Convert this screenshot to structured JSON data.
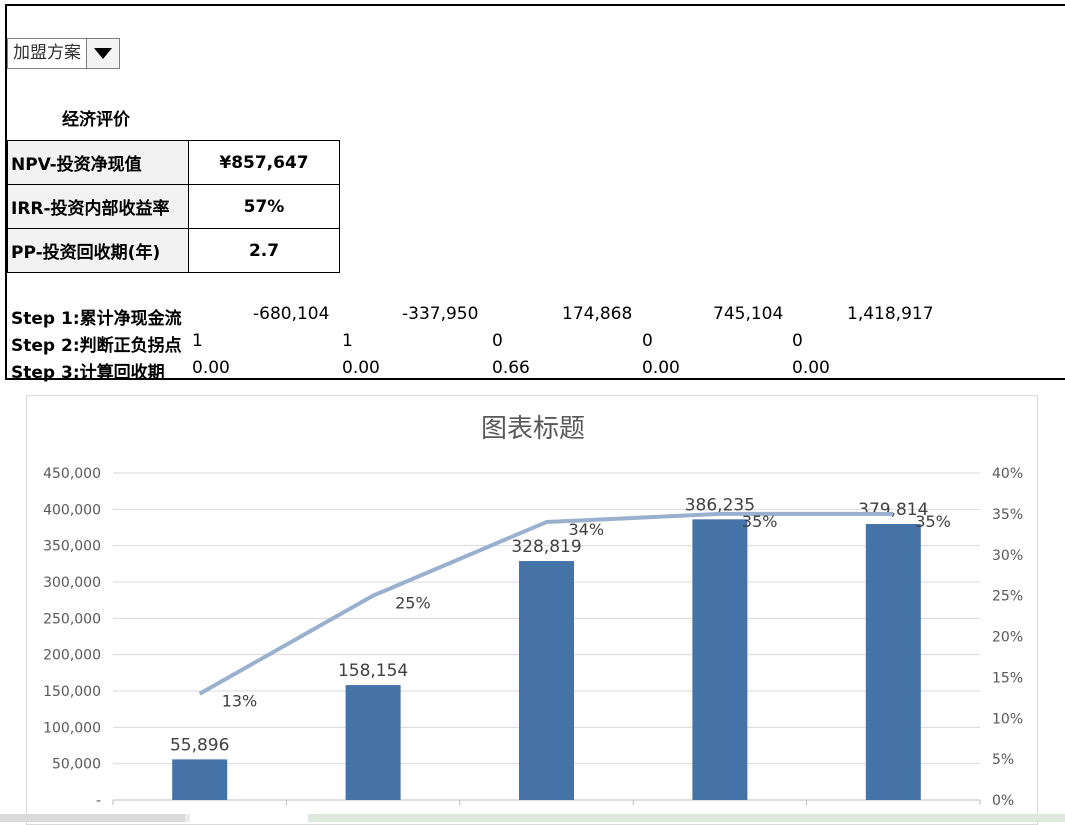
{
  "dropdown": {
    "value": "加盟方案"
  },
  "evaluation": {
    "title": "经济评价",
    "rows": [
      {
        "label": "NPV-投资净现值",
        "value": "¥857,647"
      },
      {
        "label": "IRR-投资内部收益率",
        "value": "57%"
      },
      {
        "label": "PP-投资回收期(年)",
        "value": "2.7"
      }
    ]
  },
  "steps": [
    {
      "label": "Step 1:累计净现金流",
      "values": [
        "-680,104",
        "-337,950",
        "174,868",
        "745,104",
        "1,418,917"
      ]
    },
    {
      "label": "Step 2:判断正负拐点",
      "values": [
        "1",
        "1",
        "0",
        "0",
        "0"
      ]
    },
    {
      "label": "Step 3:计算回收期",
      "values": [
        "0.00",
        "0.00",
        "0.66",
        "0.00",
        "0.00"
      ]
    }
  ],
  "colors": {
    "bar": "#4573a7",
    "line": "#99b0cf",
    "grid": "#d9d9d9",
    "text": "#595959"
  },
  "chart_data": {
    "type": "bar",
    "title": "图表标题",
    "categories": [
      "",
      "",
      "",
      "",
      ""
    ],
    "ylim": [
      0,
      450000
    ],
    "y2lim": [
      0,
      0.4
    ],
    "yticks": [
      "-",
      "50,000",
      "100,000",
      "150,000",
      "200,000",
      "250,000",
      "300,000",
      "350,000",
      "400,000",
      "450,000"
    ],
    "y2ticks": [
      "0%",
      "5%",
      "10%",
      "15%",
      "20%",
      "25%",
      "30%",
      "35%",
      "40%"
    ],
    "grid": true,
    "series": [
      {
        "type": "bar",
        "axis": "left",
        "values": [
          55896,
          158154,
          328819,
          386235,
          379814
        ],
        "labels": [
          "55,896",
          "158,154",
          "328,819",
          "386,235",
          "379,814"
        ]
      },
      {
        "type": "line",
        "axis": "right",
        "values": [
          0.13,
          0.25,
          0.34,
          0.35,
          0.35
        ],
        "labels": [
          "13%",
          "25%",
          "34%",
          "35%",
          "35%"
        ]
      }
    ]
  }
}
